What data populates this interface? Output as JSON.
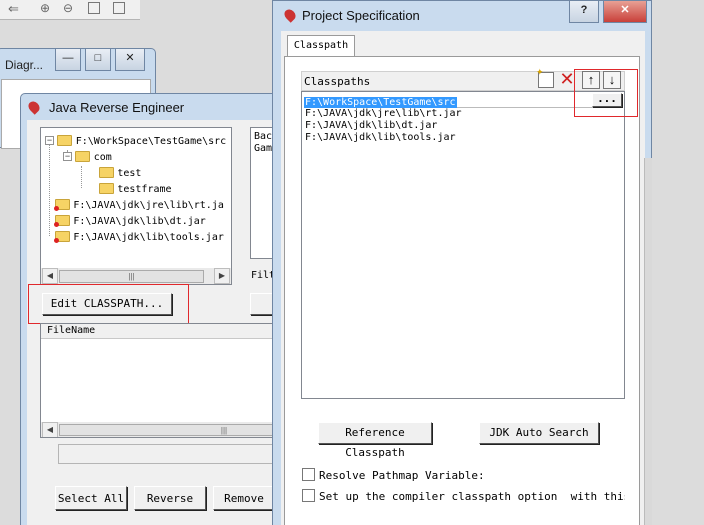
{
  "diagram_window": {
    "title": "Diagr..."
  },
  "reverse_window": {
    "title": "Java Reverse Engineer",
    "tree": [
      {
        "label": "F:\\WorkSpace\\TestGame\\src",
        "level": 0
      },
      {
        "label": "com",
        "level": 1
      },
      {
        "label": "test",
        "level": 2
      },
      {
        "label": "testframe",
        "level": 2
      },
      {
        "label": "F:\\JAVA\\jdk\\jre\\lib\\rt.ja",
        "level": 0
      },
      {
        "label": "F:\\JAVA\\jdk\\lib\\dt.jar",
        "level": 0
      },
      {
        "label": "F:\\JAVA\\jdk\\lib\\tools.jar",
        "level": 0
      }
    ],
    "right_list_lines": [
      "Bac",
      "Gam"
    ],
    "filter_label": "Filt",
    "edit_classpath_label": "Edit CLASSPATH...",
    "filename_header": "FileName",
    "select_all_label": "Select All",
    "reverse_label": "Reverse",
    "remove_label": "Remove"
  },
  "spec_window": {
    "title": "Project Specification",
    "tab_label": "Classpath",
    "classpaths_label": "Classpaths",
    "classpaths": [
      "F:\\WorkSpace\\TestGame\\src",
      "F:\\JAVA\\jdk\\jre\\lib\\rt.jar",
      "F:\\JAVA\\jdk\\lib\\dt.jar",
      "F:\\JAVA\\jdk\\lib\\tools.jar"
    ],
    "browse_label": "...",
    "reference_classpath_label": "Reference Classpath",
    "jdk_auto_search_label": "JDK Auto Search",
    "resolve_pathmap_label": "Resolve Pathmap Variable:",
    "compiler_classpath_label": "Set up the compiler classpath option  with this pro",
    "close_glyph": "✕",
    "help_glyph": "?"
  },
  "colors": {
    "selection": "#3399ff",
    "highlight_box": "#e0282c",
    "close_button": "#c9403a"
  }
}
